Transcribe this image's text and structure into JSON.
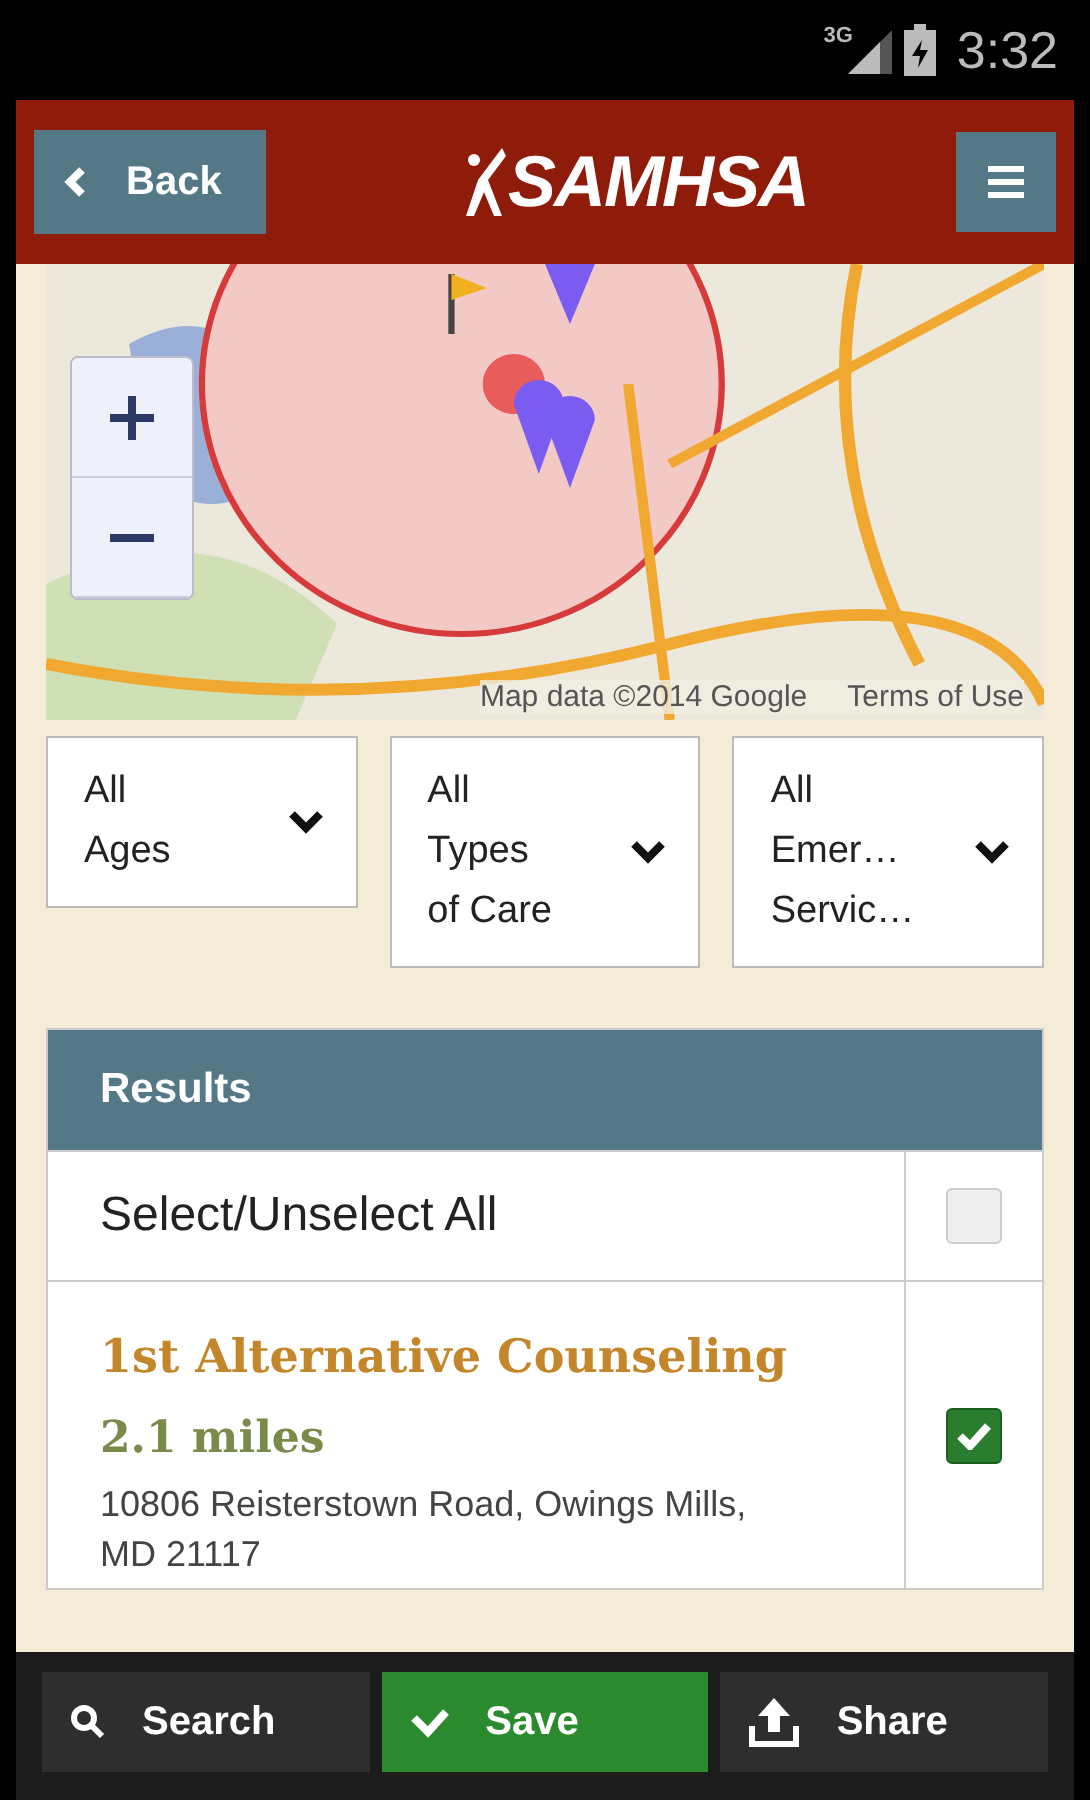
{
  "status_bar": {
    "network": "3G",
    "time": "3:32"
  },
  "header": {
    "back_label": "Back",
    "logo": "SAMHSA"
  },
  "map": {
    "kind": "picture",
    "attribution": "Map data ©2014 Google",
    "terms": "Terms of Use"
  },
  "filters": [
    {
      "lines": [
        "All",
        "Ages"
      ]
    },
    {
      "lines": [
        "All",
        "Types",
        "of Care"
      ]
    },
    {
      "lines": [
        "All",
        "Emer…",
        "Servic…"
      ]
    }
  ],
  "results": {
    "title": "Results",
    "select_all": {
      "label": "Select/Unselect All",
      "checked": false
    },
    "items": [
      {
        "name": "1st Alternative Counseling",
        "distance": "2.1 miles",
        "address": "10806 Reisterstown Road, Owings Mills, MD 21117",
        "checked": true
      }
    ]
  },
  "bottom_bar": [
    {
      "label": "Search",
      "kind": "search",
      "selected": false
    },
    {
      "label": "Save",
      "kind": "save",
      "selected": true
    },
    {
      "label": "Share",
      "kind": "share",
      "selected": false
    }
  ]
}
